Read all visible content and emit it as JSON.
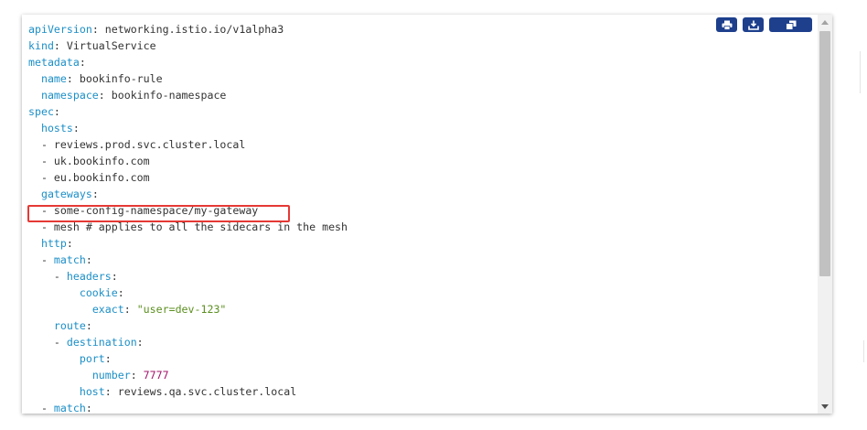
{
  "toolbar": {
    "print_icon": "printer-icon",
    "download_icon": "download-icon",
    "copy_icon": "copy-icon",
    "button_color": "#1d3f8c"
  },
  "highlight": {
    "color": "#e53935",
    "target_line_index": 12
  },
  "colors": {
    "key": "#1c8fc7",
    "string": "#5b8f1f",
    "number": "#a3146c",
    "text": "#333333"
  },
  "code": {
    "language": "yaml",
    "lines": [
      {
        "indent": "",
        "key": "apiVersion",
        "sep": ": ",
        "value": "networking.istio.io/v1alpha3",
        "vtype": "plain"
      },
      {
        "indent": "",
        "key": "kind",
        "sep": ": ",
        "value": "VirtualService",
        "vtype": "plain"
      },
      {
        "indent": "",
        "key": "metadata",
        "sep": ":",
        "value": "",
        "vtype": "plain"
      },
      {
        "indent": "  ",
        "key": "name",
        "sep": ": ",
        "value": "bookinfo-rule",
        "vtype": "plain"
      },
      {
        "indent": "  ",
        "key": "namespace",
        "sep": ": ",
        "value": "bookinfo-namespace",
        "vtype": "plain"
      },
      {
        "indent": "",
        "key": "spec",
        "sep": ":",
        "value": "",
        "vtype": "plain"
      },
      {
        "indent": "  ",
        "key": "hosts",
        "sep": ":",
        "value": "",
        "vtype": "plain"
      },
      {
        "indent": "  - ",
        "key": "",
        "sep": "",
        "value": "reviews.prod.svc.cluster.local",
        "vtype": "plain"
      },
      {
        "indent": "  - ",
        "key": "",
        "sep": "",
        "value": "uk.bookinfo.com",
        "vtype": "plain"
      },
      {
        "indent": "  - ",
        "key": "",
        "sep": "",
        "value": "eu.bookinfo.com",
        "vtype": "plain"
      },
      {
        "indent": "  ",
        "key": "gateways",
        "sep": ":",
        "value": "",
        "vtype": "plain"
      },
      {
        "indent": "  - ",
        "key": "",
        "sep": "",
        "value": "some-config-namespace/my-gateway",
        "vtype": "plain"
      },
      {
        "indent": "  - ",
        "key": "",
        "sep": "",
        "value": "mesh # applies to all the sidecars in the mesh",
        "vtype": "plain"
      },
      {
        "indent": "  ",
        "key": "http",
        "sep": ":",
        "value": "",
        "vtype": "plain"
      },
      {
        "indent": "  - ",
        "key": "match",
        "sep": ":",
        "value": "",
        "vtype": "plain"
      },
      {
        "indent": "    - ",
        "key": "headers",
        "sep": ":",
        "value": "",
        "vtype": "plain"
      },
      {
        "indent": "        ",
        "key": "cookie",
        "sep": ":",
        "value": "",
        "vtype": "plain"
      },
      {
        "indent": "          ",
        "key": "exact",
        "sep": ": ",
        "value": "\"user=dev-123\"",
        "vtype": "str"
      },
      {
        "indent": "    ",
        "key": "route",
        "sep": ":",
        "value": "",
        "vtype": "plain"
      },
      {
        "indent": "    - ",
        "key": "destination",
        "sep": ":",
        "value": "",
        "vtype": "plain"
      },
      {
        "indent": "        ",
        "key": "port",
        "sep": ":",
        "value": "",
        "vtype": "plain"
      },
      {
        "indent": "          ",
        "key": "number",
        "sep": ": ",
        "value": "7777",
        "vtype": "num"
      },
      {
        "indent": "        ",
        "key": "host",
        "sep": ": ",
        "value": "reviews.qa.svc.cluster.local",
        "vtype": "plain"
      },
      {
        "indent": "  - ",
        "key": "match",
        "sep": ":",
        "value": "",
        "vtype": "plain"
      }
    ]
  }
}
